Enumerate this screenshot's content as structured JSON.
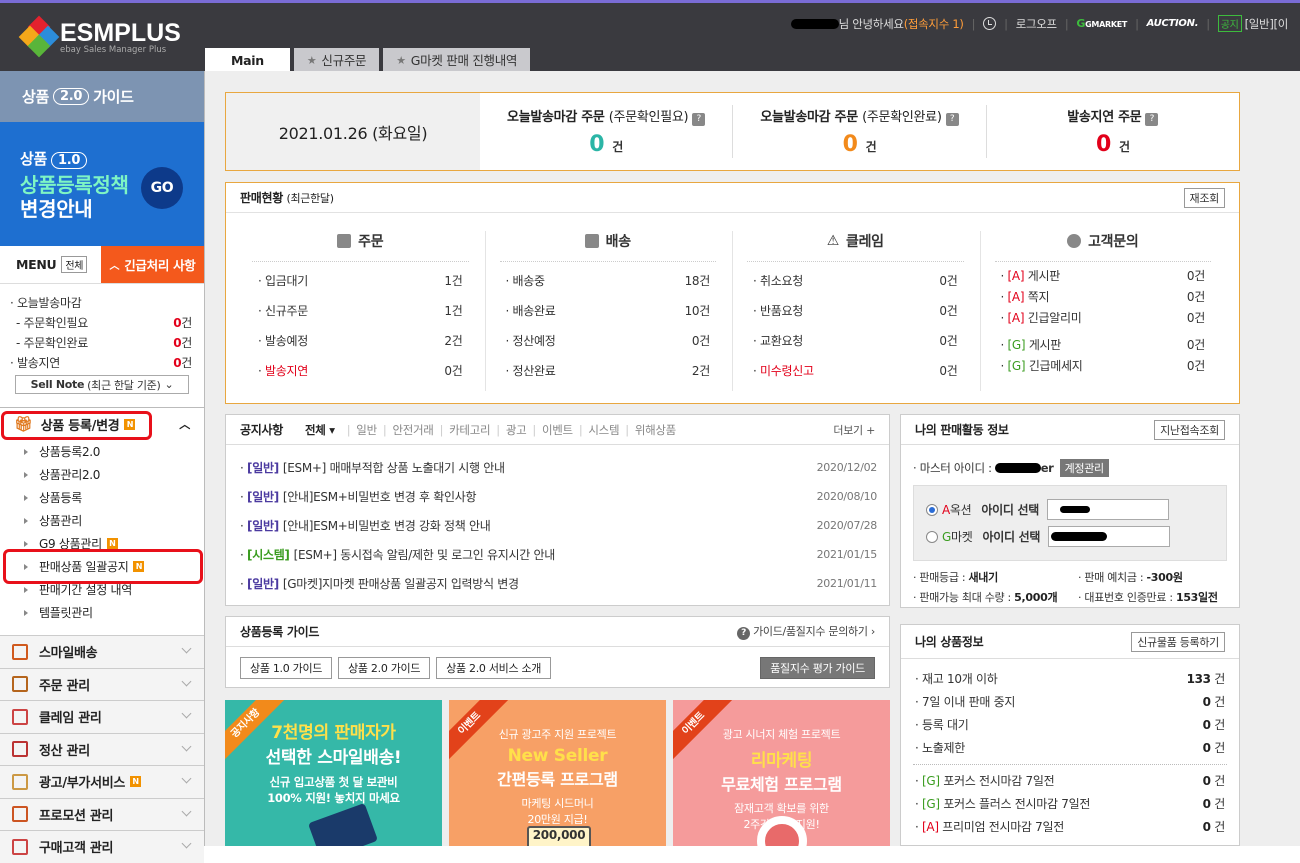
{
  "header": {
    "logo_title": "ESMPLUS",
    "logo_sub": "ebay Sales Manager Plus",
    "greeting": "님 안녕하세요",
    "access_count": "(접속지수 1)",
    "logoff": "로그오프",
    "gmarket": "GMARKET",
    "auction": "AUCTION.",
    "notice_tag": "공지",
    "notice_text": "[일반][이"
  },
  "tabs": [
    {
      "label": "Main"
    },
    {
      "label": "신규주문"
    },
    {
      "label": "G마켓 판매 진행내역"
    }
  ],
  "sidebar": {
    "guide20": {
      "prefix": "상품",
      "ver": "2.0",
      "suffix": "가이드"
    },
    "banner": {
      "prefix": "상품",
      "ver": "1.0",
      "line1": "상품등록정책",
      "line2": "변경안내",
      "go": "GO"
    },
    "menu_label": "MENU",
    "menu_all": "전체",
    "urgent_label": "긴급처리 사항",
    "urgent": {
      "today_deadline": "· 오늘발송마감",
      "need_confirm": "- 주문확인필요",
      "need_confirm_val": "0",
      "confirmed": "- 주문확인완료",
      "confirmed_val": "0",
      "delayed": "· 발송지연",
      "delayed_val": "0",
      "unit": "건"
    },
    "sellnote": "Sell Note (최근 한달 기준)",
    "section_title": "상품 등록/변경",
    "section_badge": "N",
    "items": [
      {
        "label": "상품등록2.0"
      },
      {
        "label": "상품관리2.0"
      },
      {
        "label": "상품등록"
      },
      {
        "label": "상품관리"
      },
      {
        "label": "G9 상품관리",
        "badge": "N"
      },
      {
        "label": "판매상품 일괄공지",
        "badge": "N"
      },
      {
        "label": "판매기간 설정 내역"
      },
      {
        "label": "템플릿관리"
      }
    ],
    "categories": [
      {
        "label": "스마일배송"
      },
      {
        "label": "주문 관리"
      },
      {
        "label": "클레임 관리"
      },
      {
        "label": "정산 관리"
      },
      {
        "label": "광고/부가서비스",
        "badge": "N"
      },
      {
        "label": "프로모션 관리"
      },
      {
        "label": "구매고객 관리"
      }
    ]
  },
  "today": {
    "date": "2021.01.26 (화요일)",
    "cells": [
      {
        "title": "오늘발송마감 주문",
        "note": "(주문확인필요)",
        "value": "0",
        "unit": "건",
        "color": "#2bb5a6"
      },
      {
        "title": "오늘발송마감 주문",
        "note": "(주문확인완료)",
        "value": "0",
        "unit": "건",
        "color": "#f28a1b"
      },
      {
        "title": "발송지연 주문",
        "note": "",
        "value": "0",
        "unit": "건",
        "color": "#e2001a"
      }
    ]
  },
  "sales": {
    "title": "판매현황",
    "period": "(최근한달)",
    "refresh": "재조회",
    "cols": [
      {
        "head": "주문",
        "rows": [
          {
            "label": "입금대기",
            "value": "1건"
          },
          {
            "label": "신규주문",
            "value": "1건"
          },
          {
            "label": "발송예정",
            "value": "2건"
          },
          {
            "label": "발송지연",
            "value": "0건"
          }
        ]
      },
      {
        "head": "배송",
        "rows": [
          {
            "label": "배송중",
            "value": "18건"
          },
          {
            "label": "배송완료",
            "value": "10건"
          },
          {
            "label": "정산예정",
            "value": "0건"
          },
          {
            "label": "정산완료",
            "value": "2건"
          }
        ]
      },
      {
        "head": "클레임",
        "rows": [
          {
            "label": "취소요청",
            "value": "0건"
          },
          {
            "label": "반품요청",
            "value": "0건"
          },
          {
            "label": "교환요청",
            "value": "0건"
          },
          {
            "label": "미수령신고",
            "value": "0건"
          }
        ]
      },
      {
        "head": "고객문의",
        "rows": [
          {
            "tag": "[A]",
            "label": "게시판",
            "value": "0건"
          },
          {
            "tag": "[A]",
            "label": "쪽지",
            "value": "0건"
          },
          {
            "tag": "[A]",
            "label": "긴급알리미",
            "value": "0건"
          },
          {
            "tag": "[G]",
            "label": "게시판",
            "value": "0건"
          },
          {
            "tag": "[G]",
            "label": "긴급메세지",
            "value": "0건"
          }
        ]
      }
    ]
  },
  "notice": {
    "title": "공지사항",
    "filters": [
      "전체",
      "일반",
      "안전거래",
      "카테고리",
      "광고",
      "이벤트",
      "시스템",
      "위해상품"
    ],
    "more": "더보기 +",
    "items": [
      {
        "tag": "[일반]",
        "text": "[ESM+] 매매부적합 상품 노출대기 시행 안내",
        "date": "2020/12/02"
      },
      {
        "tag": "[일반]",
        "text": "[안내]ESM+비밀번호 변경 후 확인사항",
        "date": "2020/08/10"
      },
      {
        "tag": "[일반]",
        "text": "[안내]ESM+비밀번호 변경 강화 정책 안내",
        "date": "2020/07/28"
      },
      {
        "tag": "[시스템]",
        "text": "[ESM+] 동시접속 알림/제한 및 로그인 유지시간 안내",
        "date": "2021/01/15"
      },
      {
        "tag": "[일반]",
        "text": "[G마켓]지마켓 판매상품 일괄공지 입력방식 변경",
        "date": "2021/01/11"
      }
    ]
  },
  "guide": {
    "title": "상품등록 가이드",
    "help": "가이드/품질지수 문의하기",
    "buttons": [
      "상품 1.0 가이드",
      "상품 2.0 가이드",
      "상품 2.0 서비스 소개"
    ],
    "quality_btn": "품질지수 평가 가이드"
  },
  "promos": [
    {
      "ribbon": "공지사항",
      "l1": "7천명의 판매자가",
      "l2": "선택한 스마일배송!",
      "l3": "신규 입고상품 첫 달 보관비",
      "l4": "100% 지원! 놓치지 마세요"
    },
    {
      "ribbon": "이벤트",
      "l1": "신규 광고주 지원 프로젝트",
      "l2": "New Seller",
      "l3": "간편등록 프로그램",
      "l4": "마케팅 시드머니",
      "l5": "20만원 지급!",
      "l6": "200,000"
    },
    {
      "ribbon": "이벤트",
      "l1": "광고 시너지 체험 프로젝트",
      "l2": "리마케팅",
      "l3": "무료체험 프로그램",
      "l4": "잠재고객 확보를 위한",
      "l5": "2주간 무료 지원!"
    }
  ],
  "activity": {
    "title": "나의 판매활동 정보",
    "btn": "지난접속조회",
    "master": "· 마스터 아이디 :",
    "master_id_tail": "er",
    "manage_btn": "계정관리",
    "auction_sel": "옥션",
    "gmarket_sel": "마켓",
    "select_label": "아이디 선택",
    "grade_label": "· 판매등급 :",
    "grade": "새내기",
    "deposit_label": "· 판매 예치금 :",
    "deposit": "-300원",
    "max_label": "· 판매가능 최대 수량 :",
    "max": "5,000개",
    "cert_label": "· 대표번호 인증만료 :",
    "cert": "153일전"
  },
  "product": {
    "title": "나의 상품정보",
    "btn": "신규물품 등록하기",
    "rows": [
      {
        "label": "재고 10개 이하",
        "value": "133",
        "unit": "건"
      },
      {
        "label": "7일 이내 판매 중지",
        "value": "0",
        "unit": "건"
      },
      {
        "label": "등록 대기",
        "value": "0",
        "unit": "건"
      },
      {
        "label": "노출제한",
        "value": "0",
        "unit": "건"
      },
      {
        "tag": "[G]",
        "label": "포커스 전시마감 7일전",
        "value": "0",
        "unit": "건"
      },
      {
        "tag": "[G]",
        "label": "포커스 플러스 전시마감 7일전",
        "value": "0",
        "unit": "건"
      },
      {
        "tag": "[A]",
        "label": "프리미엄 전시마감 7일전",
        "value": "0",
        "unit": "건"
      }
    ]
  }
}
